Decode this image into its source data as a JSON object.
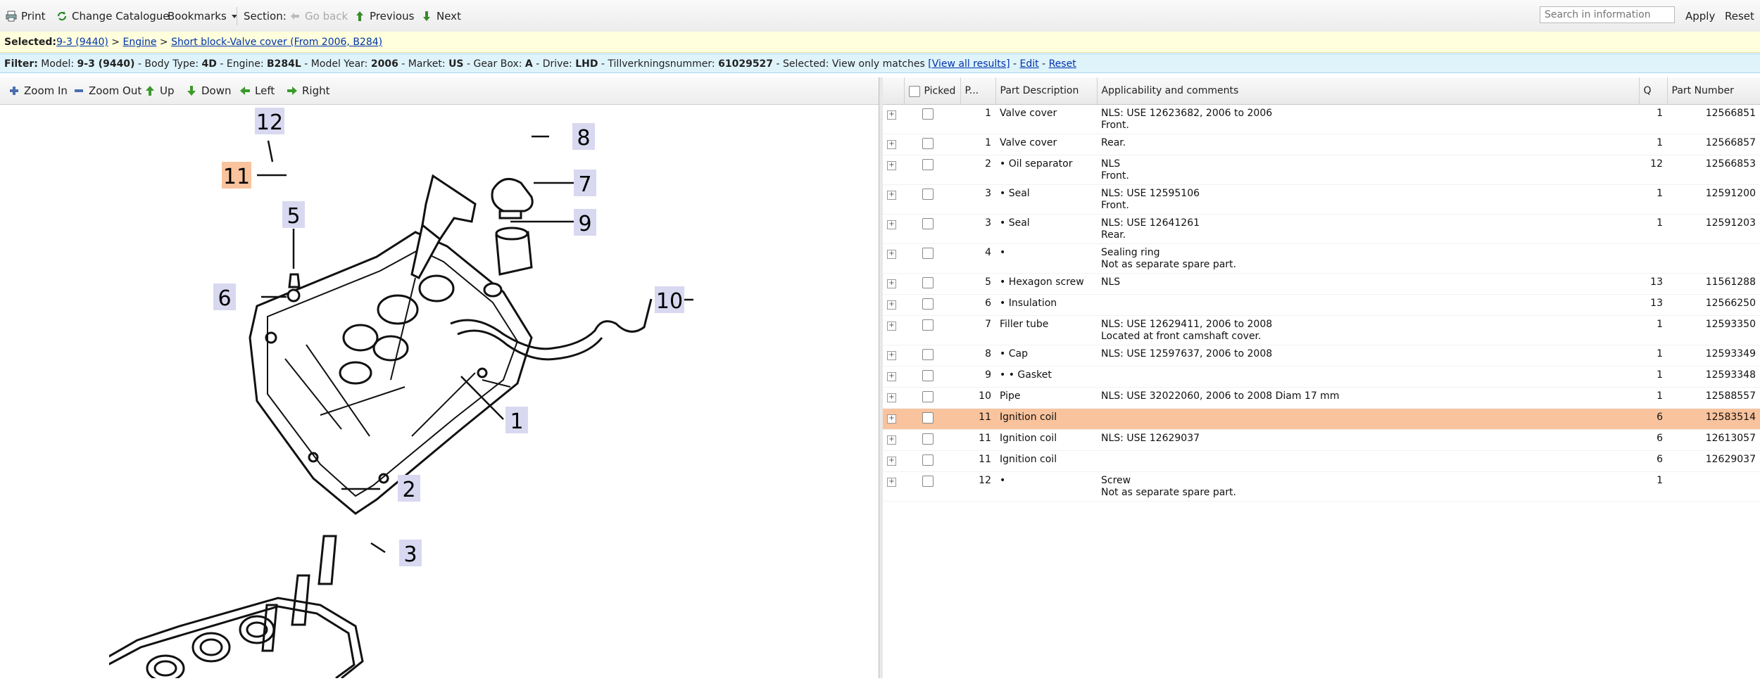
{
  "toolbar": {
    "print": "Print",
    "change_catalogue": "Change Catalogue",
    "bookmarks": "Bookmarks",
    "section": "Section:",
    "go_back": "Go back",
    "previous": "Previous",
    "next": "Next",
    "search_placeholder": "Search in information",
    "apply": "Apply",
    "reset": "Reset"
  },
  "selected": {
    "label": "Selected:",
    "crumbs": [
      "9-3 (9440)",
      "Engine",
      "Short block-Valve cover (From 2006, B284)"
    ],
    "sep": " > "
  },
  "filter": {
    "label": "Filter:",
    "model_label": " Model: ",
    "model": "9-3 (9440)",
    "body_label": " - Body Type: ",
    "body": "4D",
    "engine_label": " - Engine: ",
    "engine": "B284L",
    "year_label": " - Model Year: ",
    "year": "2006",
    "market_label": " - Market: ",
    "market": "US",
    "gearbox_label": " - Gear Box: ",
    "gearbox": "A",
    "drive_label": " - Drive: ",
    "drive": "LHD",
    "tillv_label": " - Tillverkningsnummer: ",
    "tillv": "61029527",
    "selected_label": " - Selected: ",
    "selected_text": "View only matches ",
    "view_all": "[View all results]",
    "edit": "Edit",
    "reset": "Reset",
    "dash": " - "
  },
  "image_toolbar": {
    "zoom_in": "Zoom In",
    "zoom_out": "Zoom Out",
    "up": "Up",
    "down": "Down",
    "left": "Left",
    "right": "Right"
  },
  "diagram": {
    "labels": [
      "12",
      "11",
      "8",
      "7",
      "9",
      "5",
      "6",
      "10",
      "1",
      "2",
      "3"
    ]
  },
  "table": {
    "headers": {
      "picked": "Picked",
      "pos": "P...",
      "desc": "Part Description",
      "appl": "Applicability and comments",
      "qty": "Q",
      "partno": "Part Number"
    },
    "rows": [
      {
        "pos": "1",
        "desc": "Valve cover",
        "appl1": "NLS: USE 12623682, 2006 to 2006",
        "appl2": "Front.",
        "qty": "1",
        "partno": "12566851"
      },
      {
        "pos": "1",
        "desc": "Valve cover",
        "appl1": "",
        "appl2": "Rear.",
        "qty": "1",
        "partno": "12566857"
      },
      {
        "pos": "2",
        "desc": "• Oil separator",
        "appl1": "NLS",
        "appl2": "Front.",
        "qty": "12",
        "partno": "12566853"
      },
      {
        "pos": "3",
        "desc": "• Seal",
        "appl1": "NLS: USE 12595106",
        "appl2": "Front.",
        "qty": "1",
        "partno": "12591200"
      },
      {
        "pos": "3",
        "desc": "• Seal",
        "appl1": "NLS: USE 12641261",
        "appl2": "Rear.",
        "qty": "1",
        "partno": "12591203"
      },
      {
        "pos": "4",
        "desc": "•",
        "appl1": "Sealing ring",
        "appl2": "Not as separate spare part.",
        "qty": "",
        "partno": ""
      },
      {
        "pos": "5",
        "desc": "• Hexagon screw",
        "appl1": "NLS",
        "appl2": "",
        "qty": "13",
        "partno": "11561288"
      },
      {
        "pos": "6",
        "desc": "• Insulation",
        "appl1": "",
        "appl2": "",
        "qty": "13",
        "partno": "12566250"
      },
      {
        "pos": "7",
        "desc": "Filler tube",
        "appl1": "NLS: USE 12629411, 2006 to 2008",
        "appl2": "Located at front camshaft cover.",
        "qty": "1",
        "partno": "12593350"
      },
      {
        "pos": "8",
        "desc": "• Cap",
        "appl1": "NLS: USE 12597637, 2006 to 2008",
        "appl2": "",
        "qty": "1",
        "partno": "12593349"
      },
      {
        "pos": "9",
        "desc": "• • Gasket",
        "appl1": "",
        "appl2": "",
        "qty": "1",
        "partno": "12593348"
      },
      {
        "pos": "10",
        "desc": "Pipe",
        "appl1": "NLS: USE 32022060, 2006 to 2008 Diam 17 mm",
        "appl2": "",
        "qty": "1",
        "partno": "12588557"
      },
      {
        "pos": "11",
        "desc": "Ignition coil",
        "appl1": "",
        "appl2": "",
        "qty": "6",
        "partno": "12583514",
        "highlight": true
      },
      {
        "pos": "11",
        "desc": "Ignition coil",
        "appl1": "NLS: USE 12629037",
        "appl2": "",
        "qty": "6",
        "partno": "12613057"
      },
      {
        "pos": "11",
        "desc": "Ignition coil",
        "appl1": "",
        "appl2": "",
        "qty": "6",
        "partno": "12629037"
      },
      {
        "pos": "12",
        "desc": "•",
        "appl1": "Screw",
        "appl2": "Not as separate spare part.",
        "qty": "1",
        "partno": ""
      }
    ]
  },
  "colors": {
    "highlight": "#f9c39d",
    "callout_bg": "#d8d8f0",
    "callout_active": "#f9c39d",
    "filter_bar": "#dff3fb",
    "selected_bar": "#ffffdd"
  }
}
